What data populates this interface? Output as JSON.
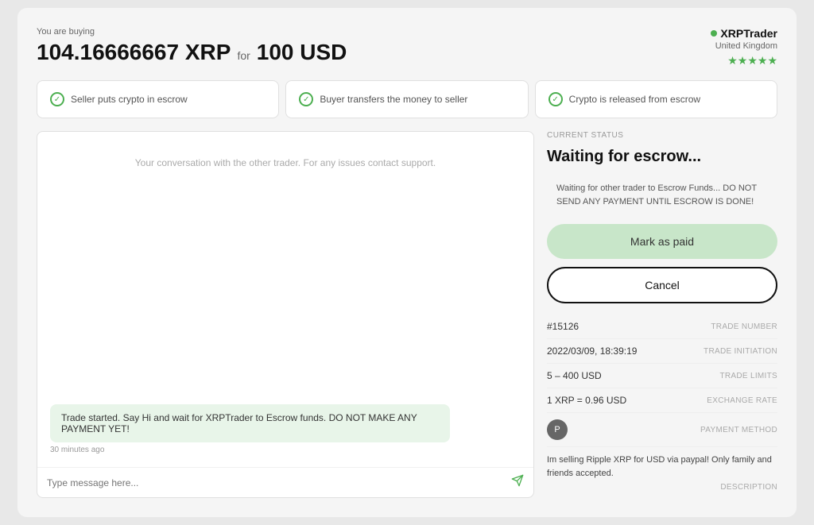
{
  "header": {
    "buying_label": "You are buying",
    "crypto_amount": "104.16666667 XRP",
    "for_text": "for",
    "fiat_amount": "100 USD"
  },
  "trader": {
    "name": "XRPTrader",
    "country": "United Kingdom",
    "stars": "★★★★★"
  },
  "steps": [
    {
      "label": "Seller puts crypto in escrow",
      "active": true
    },
    {
      "label": "Buyer transfers the money to seller",
      "active": true
    },
    {
      "label": "Crypto is released from escrow",
      "active": true
    }
  ],
  "chat": {
    "placeholder": "Your conversation with the other trader. For any issues contact support.",
    "message": "Trade started. Say Hi and wait for XRPTrader to Escrow funds. DO NOT MAKE ANY PAYMENT YET!",
    "timestamp": "30 minutes ago",
    "input_placeholder": "Type message here..."
  },
  "status": {
    "current_label": "CURRENT STATUS",
    "title": "Waiting for escrow...",
    "warning": "Waiting for other trader to Escrow Funds... DO NOT SEND ANY PAYMENT UNTIL ESCROW IS DONE!"
  },
  "buttons": {
    "mark_paid": "Mark as paid",
    "cancel": "Cancel"
  },
  "trade_details": {
    "trade_number_value": "#15126",
    "trade_number_label": "TRADE NUMBER",
    "trade_initiation_value": "2022/03/09, 18:39:19",
    "trade_initiation_label": "TRADE INITIATION",
    "trade_limits_value": "5 – 400 USD",
    "trade_limits_label": "TRADE LIMITS",
    "exchange_rate_value": "1 XRP = 0.96 USD",
    "exchange_rate_label": "EXCHANGE RATE",
    "payment_method_label": "PAYMENT METHOD",
    "payment_icon_text": "P",
    "description_text": "Im selling Ripple XRP for USD via paypal! Only family and friends accepted.",
    "description_label": "DESCRIPTION"
  }
}
